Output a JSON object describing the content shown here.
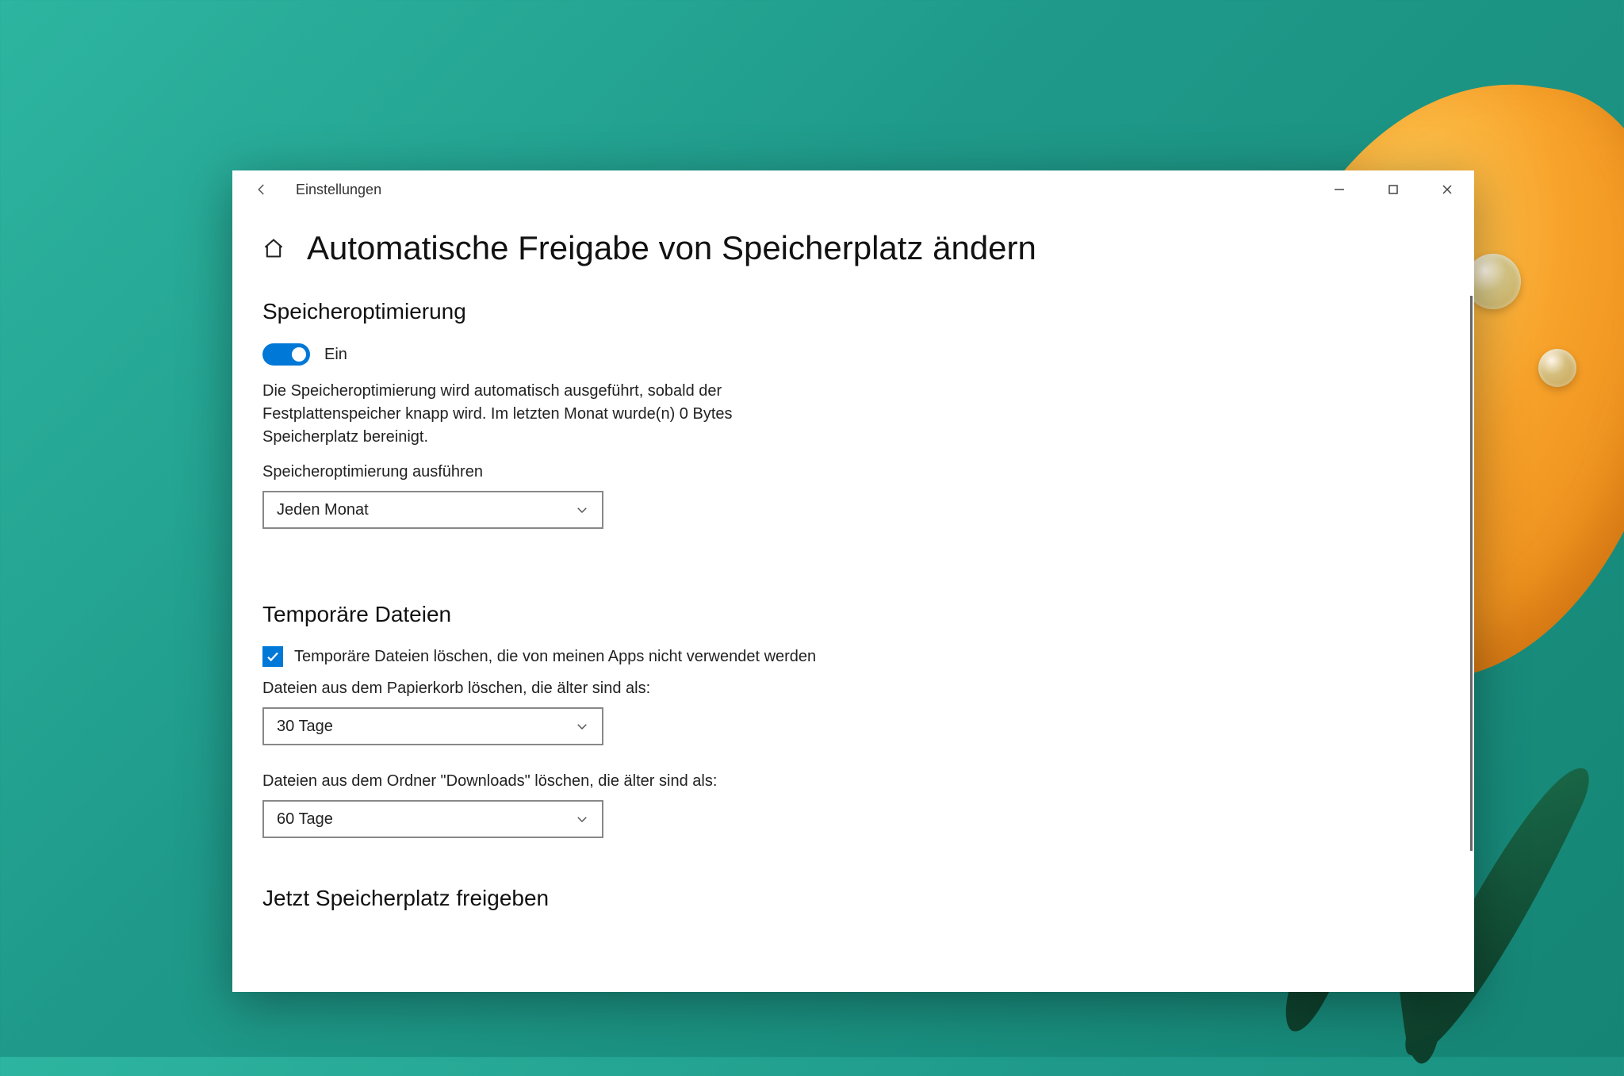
{
  "window": {
    "app_title": "Einstellungen"
  },
  "page": {
    "title": "Automatische Freigabe von Speicherplatz ändern"
  },
  "section1": {
    "title": "Speicheroptimierung",
    "toggle_state": "Ein",
    "description": "Die Speicheroptimierung wird automatisch ausgeführt, sobald der Festplattenspeicher knapp wird. Im letzten Monat wurde(n) 0 Bytes Speicherplatz bereinigt.",
    "run_label": "Speicheroptimierung ausführen",
    "run_value": "Jeden Monat"
  },
  "section2": {
    "title": "Temporäre Dateien",
    "checkbox_label": "Temporäre Dateien löschen, die von meinen Apps nicht verwendet werden",
    "recycle_label": "Dateien aus dem Papierkorb löschen, die älter sind als:",
    "recycle_value": "30 Tage",
    "downloads_label": "Dateien aus dem Ordner \"Downloads\" löschen, die älter sind als:",
    "downloads_value": "60 Tage"
  },
  "section3": {
    "title": "Jetzt Speicherplatz freigeben"
  }
}
